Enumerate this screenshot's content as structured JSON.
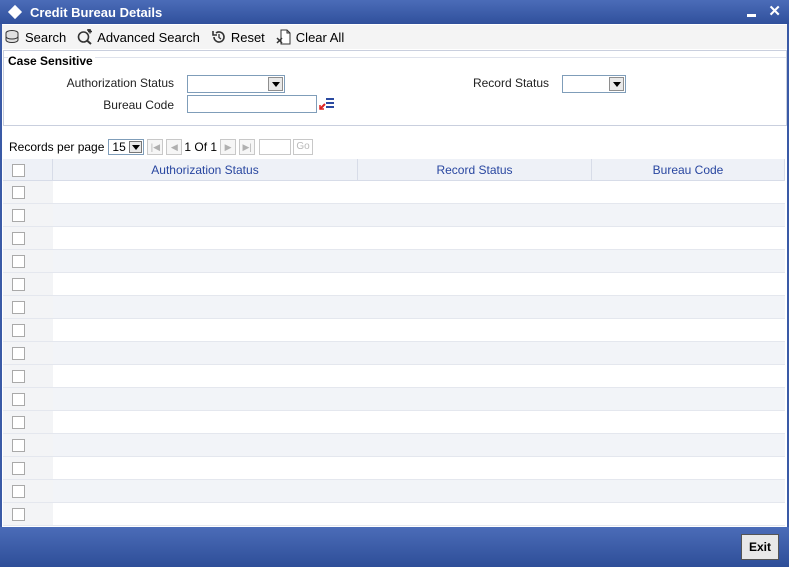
{
  "window": {
    "title": "Credit Bureau Details",
    "close_glyph": "✕"
  },
  "toolbar": {
    "items": [
      {
        "label": "Search",
        "icon": "search-db-icon"
      },
      {
        "label": "Advanced Search",
        "icon": "advanced-search-icon"
      },
      {
        "label": "Reset",
        "icon": "reset-icon"
      },
      {
        "label": "Clear All",
        "icon": "clear-all-icon"
      }
    ]
  },
  "criteria": {
    "legend": "Case Sensitive",
    "fields": {
      "authorization_status": {
        "label": "Authorization Status",
        "value": ""
      },
      "record_status": {
        "label": "Record Status",
        "value": ""
      },
      "bureau_code": {
        "label": "Bureau Code",
        "value": ""
      }
    }
  },
  "pager": {
    "records_per_page_label": "Records per page",
    "records_per_page": "15",
    "page_text": "1 Of 1",
    "go_label": "Go"
  },
  "grid": {
    "columns": [
      "Authorization Status",
      "Record Status",
      "Bureau Code"
    ],
    "row_count": 15
  },
  "footer": {
    "exit_label": "Exit"
  },
  "colors": {
    "frame": "#3a5aa6",
    "column_header_text": "#2846a0"
  }
}
